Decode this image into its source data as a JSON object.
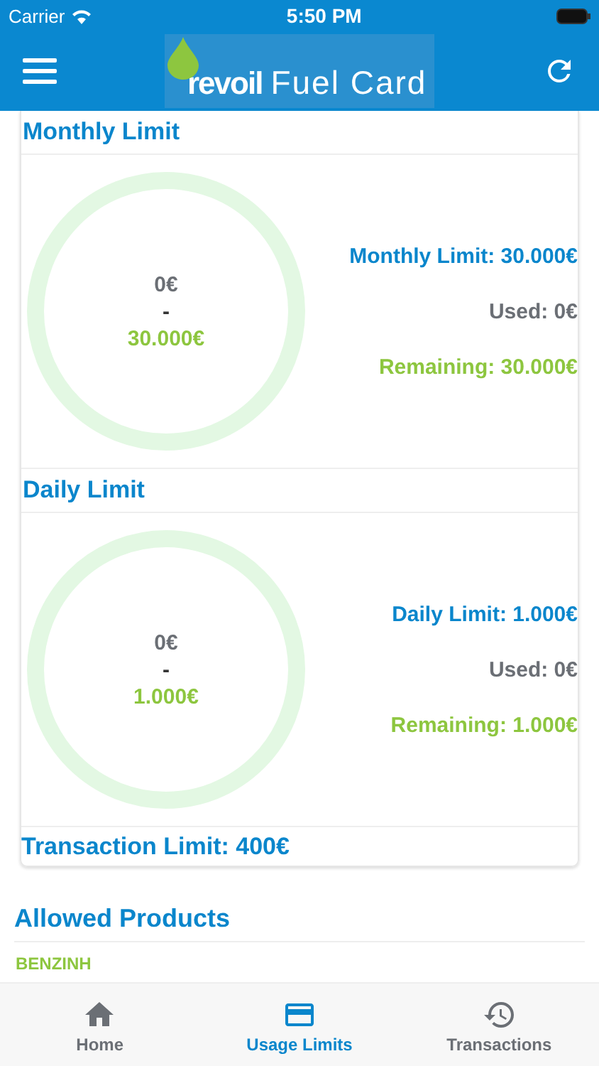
{
  "status_bar": {
    "carrier": "Carrier",
    "time": "5:50 PM"
  },
  "header": {
    "logo_word": "revoil",
    "title": "Fuel Card"
  },
  "limits": [
    {
      "title": "Monthly Limit",
      "used": "0€",
      "separator": "-",
      "remaining": "30.000€",
      "limit_line": "Monthly Limit: 30.000€",
      "used_line": "Used: 0€",
      "remaining_line": "Remaining: 30.000€"
    },
    {
      "title": "Daily Limit",
      "used": "0€",
      "separator": "-",
      "remaining": "1.000€",
      "limit_line": "Daily Limit: 1.000€",
      "used_line": "Used: 0€",
      "remaining_line": "Remaining: 1.000€"
    }
  ],
  "transaction_limit": "Transaction Limit: 400€",
  "allowed_products": {
    "title": "Allowed Products",
    "items": [
      "BENZINH"
    ]
  },
  "tabs": [
    {
      "label": "Home",
      "kind": "home",
      "selected": false
    },
    {
      "label": "Usage Limits",
      "kind": "card",
      "selected": true
    },
    {
      "label": "Transactions",
      "kind": "history",
      "selected": false
    }
  ]
}
